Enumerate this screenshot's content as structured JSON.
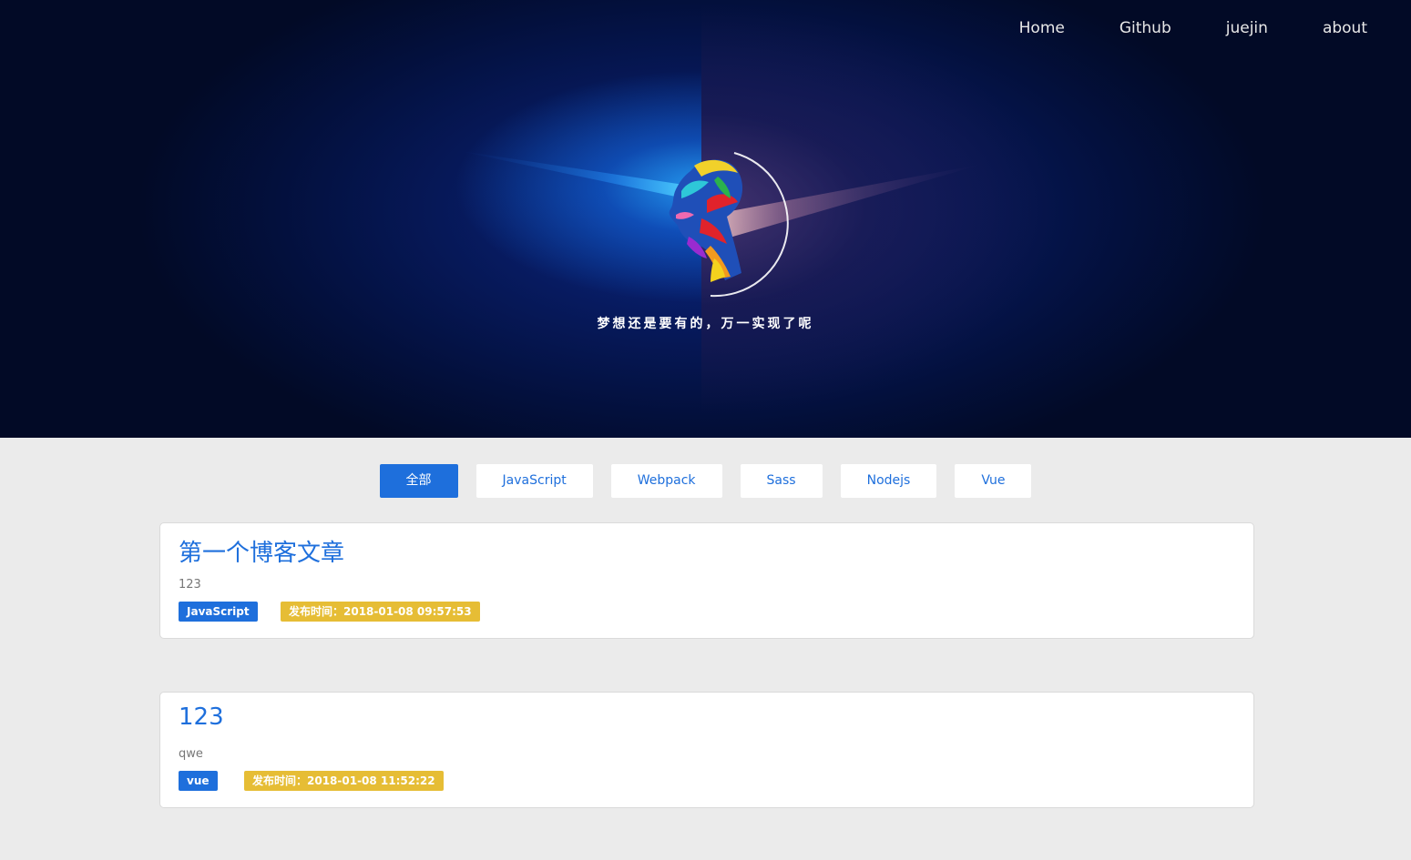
{
  "nav": {
    "items": [
      {
        "label": "Home"
      },
      {
        "label": "Github"
      },
      {
        "label": "juejin"
      },
      {
        "label": "about"
      }
    ]
  },
  "hero": {
    "avatar_icon": "colorful-head-avatar-icon",
    "slogan": "梦想还是要有的，万一实现了呢"
  },
  "filters": {
    "active": "全部",
    "items": [
      {
        "label": "全部"
      },
      {
        "label": "JavaScript"
      },
      {
        "label": "Webpack"
      },
      {
        "label": "Sass"
      },
      {
        "label": "Nodejs"
      },
      {
        "label": "Vue"
      }
    ]
  },
  "posts": [
    {
      "title": "第一个博客文章",
      "summary": "123",
      "category": "JavaScript",
      "date": "发布时间：2018-01-08 09:57:53"
    },
    {
      "title": "123",
      "summary": "qwe",
      "category": "vue",
      "date": "发布时间：2018-01-08 11:52:22"
    }
  ],
  "colors": {
    "accent": "#1e6fdc",
    "date_badge": "#e6bd35",
    "page_bg": "#ebebeb",
    "hero_bg": "#03103d"
  }
}
